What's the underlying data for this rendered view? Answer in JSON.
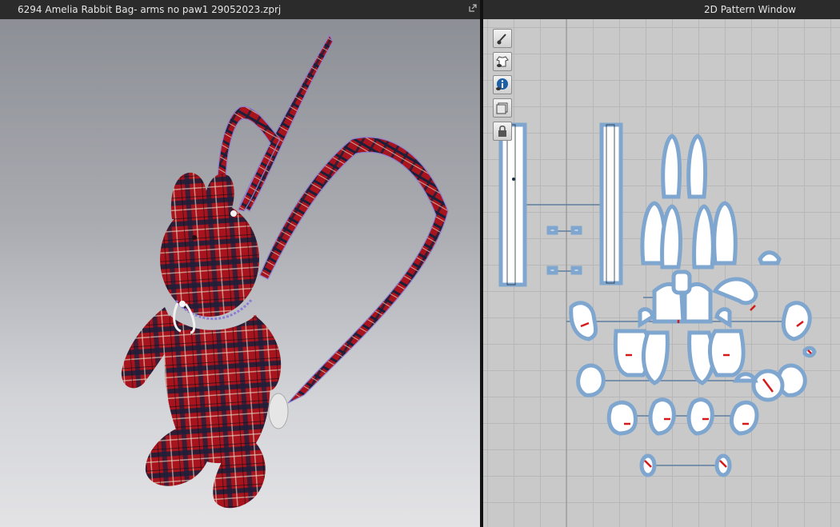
{
  "window3d": {
    "title": "6294 Amelia Rabbit Bag- arms no paw1  29052023.zprj"
  },
  "window2d": {
    "title": "2D Pattern Window"
  },
  "toolbar2d": [
    {
      "icon": "show-avatar-icon"
    },
    {
      "icon": "show-garment-icon"
    },
    {
      "icon": "info-icon"
    },
    {
      "icon": "show-texture-icon"
    },
    {
      "icon": "lock-icon"
    }
  ],
  "colors": {
    "plaid_red": "#a8141e",
    "plaid_dark": "#1a1f3a",
    "pattern_outline": "#7fa6cf",
    "grid_bg": "#c9c9c9"
  }
}
